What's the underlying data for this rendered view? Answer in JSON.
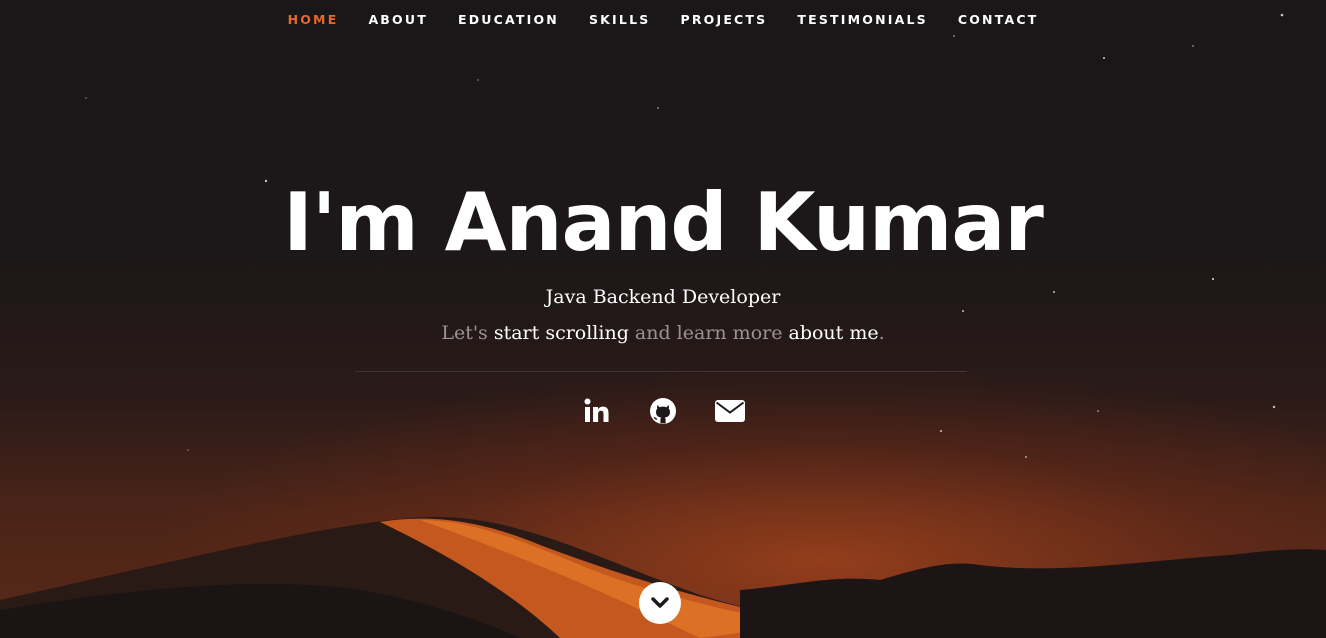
{
  "nav": {
    "items": [
      {
        "label": "HOME",
        "active": true
      },
      {
        "label": "ABOUT",
        "active": false
      },
      {
        "label": "EDUCATION",
        "active": false
      },
      {
        "label": "SKILLS",
        "active": false
      },
      {
        "label": "PROJECTS",
        "active": false
      },
      {
        "label": "TESTIMONIALS",
        "active": false
      },
      {
        "label": "CONTACT",
        "active": false
      }
    ]
  },
  "hero": {
    "title": "I'm Anand Kumar",
    "role": "Java Backend Developer",
    "tagline": {
      "part1": "Let's ",
      "link1": "start scrolling",
      "part2": " and learn more ",
      "link2": "about me",
      "part3": "."
    }
  },
  "social": [
    {
      "icon": "linkedin-icon"
    },
    {
      "icon": "github-icon"
    },
    {
      "icon": "envelope-icon"
    }
  ],
  "colors": {
    "accent": "#e7682f",
    "background": "#1a1718",
    "text": "#ffffff",
    "muted": "#9a9394"
  }
}
